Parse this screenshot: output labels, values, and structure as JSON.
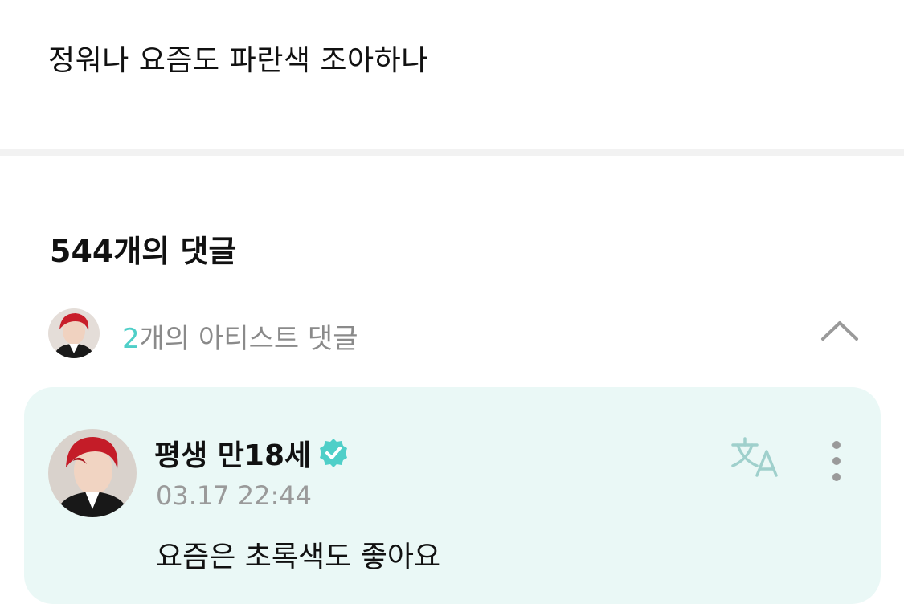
{
  "post": {
    "text": "정워나 요즘도 파란색 조아하나"
  },
  "comments": {
    "count_label": "544개의 댓글"
  },
  "artist_comments": {
    "count": "2",
    "label_suffix": "개의 아티스트 댓글",
    "expanded": true
  },
  "comment": {
    "author": "평생 만18세",
    "verified": true,
    "timestamp": "03.17 22:44",
    "body": "요즘은 초록색도 좋아요"
  },
  "colors": {
    "accent": "#4fcfc8",
    "card_background": "#eaf8f6",
    "verified_badge": "#4fcfc8"
  },
  "icons": {
    "collapse": "chevron-up-icon",
    "translate": "translate-icon",
    "more": "more-vertical-icon",
    "verified": "verified-badge-icon"
  }
}
